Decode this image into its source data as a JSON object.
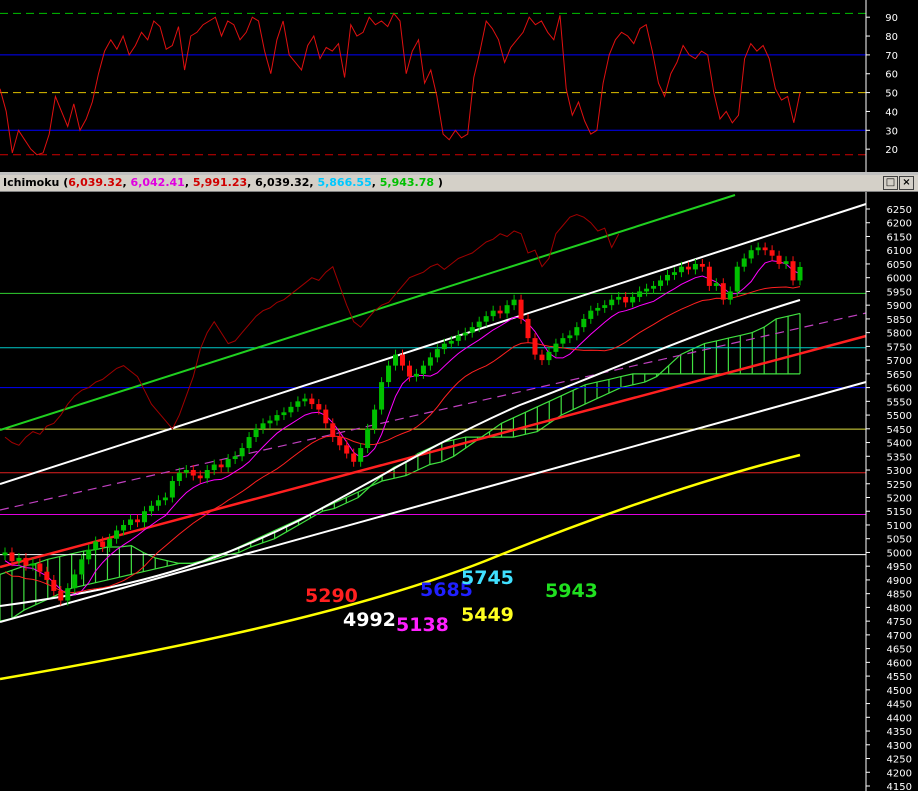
{
  "window": {
    "title": "Ichimoku",
    "values": [
      "6,039.32",
      "6,042.41",
      "5,991.23",
      "6,039.32",
      "5,866.55",
      "5,943.78"
    ],
    "value_colors": [
      "#d00000",
      "#e000e0",
      "#d00000",
      "#000000",
      "#00c8ff",
      "#00c000"
    ],
    "close_paren": ")",
    "restore_icon": "maximize-icon",
    "close_icon": "close-icon",
    "restore_glyph": "□",
    "close_glyph": "×"
  },
  "colors": {
    "background": "#000000",
    "oscillator": "#e01010",
    "up_candle": "#00c000",
    "down_candle": "#ff1010",
    "tenkan": "#ff00ff",
    "kijun": "#ff2020",
    "chikou": "#a00000",
    "cloud": "#40e040",
    "axis_text": "#ffffff"
  },
  "chart_data": [
    {
      "type": "line",
      "name": "oscillator",
      "ylim": [
        10,
        97
      ],
      "yticks": [
        20,
        30,
        40,
        50,
        60,
        70,
        80,
        90
      ],
      "reference_levels": [
        {
          "value": 92,
          "color": "#00c000",
          "dash": true
        },
        {
          "value": 70,
          "color": "#0000ff",
          "dash": false
        },
        {
          "value": 50,
          "color": "#e0c000",
          "dash": true
        },
        {
          "value": 30,
          "color": "#0000ff",
          "dash": false
        },
        {
          "value": 17,
          "color": "#d00000",
          "dash": true
        }
      ],
      "values": [
        52,
        40,
        18,
        30,
        25,
        20,
        17,
        18,
        28,
        48,
        40,
        32,
        44,
        30,
        36,
        45,
        60,
        72,
        78,
        73,
        80,
        70,
        75,
        82,
        78,
        88,
        85,
        73,
        75,
        85,
        62,
        80,
        82,
        86,
        88,
        90,
        80,
        88,
        86,
        78,
        82,
        90,
        88,
        72,
        60,
        78,
        88,
        70,
        66,
        62,
        75,
        80,
        68,
        74,
        72,
        76,
        58,
        86,
        80,
        82,
        90,
        86,
        88,
        85,
        92,
        88,
        60,
        72,
        78,
        55,
        62,
        48,
        28,
        25,
        30,
        26,
        28,
        58,
        72,
        88,
        84,
        78,
        66,
        74,
        78,
        82,
        90,
        86,
        88,
        82,
        78,
        91,
        52,
        38,
        45,
        35,
        28,
        30,
        55,
        70,
        78,
        82,
        80,
        76,
        84,
        86,
        72,
        55,
        48,
        60,
        66,
        75,
        70,
        68,
        72,
        70,
        50,
        36,
        40,
        34,
        38,
        68,
        76,
        72,
        75,
        68,
        52,
        46,
        48,
        34,
        50
      ],
      "chart_text": []
    },
    {
      "type": "candlestick",
      "name": "Ichimoku",
      "ylim": [
        4150,
        6300
      ],
      "yticks": [
        4150,
        4200,
        4250,
        4300,
        4350,
        4400,
        4450,
        4500,
        4550,
        4600,
        4650,
        4700,
        4750,
        4800,
        4850,
        4900,
        4950,
        5000,
        5050,
        5100,
        5150,
        5200,
        5250,
        5300,
        5350,
        5400,
        5450,
        5500,
        5550,
        5600,
        5650,
        5700,
        5750,
        5800,
        5850,
        5900,
        5950,
        6000,
        6050,
        6100,
        6150,
        6200,
        6250
      ],
      "close": [
        5000,
        4968,
        4980,
        4952,
        4960,
        4930,
        4900,
        4860,
        4825,
        4870,
        4920,
        4975,
        5010,
        5040,
        5020,
        5050,
        5080,
        5100,
        5120,
        5110,
        5150,
        5170,
        5190,
        5200,
        5260,
        5290,
        5300,
        5280,
        5270,
        5300,
        5320,
        5310,
        5340,
        5350,
        5380,
        5420,
        5450,
        5470,
        5480,
        5500,
        5510,
        5530,
        5550,
        5560,
        5540,
        5520,
        5470,
        5420,
        5390,
        5360,
        5330,
        5380,
        5450,
        5520,
        5620,
        5680,
        5720,
        5680,
        5640,
        5650,
        5680,
        5710,
        5740,
        5760,
        5770,
        5790,
        5800,
        5820,
        5840,
        5860,
        5880,
        5870,
        5900,
        5920,
        5850,
        5780,
        5720,
        5700,
        5730,
        5760,
        5780,
        5790,
        5820,
        5850,
        5880,
        5890,
        5900,
        5920,
        5930,
        5910,
        5930,
        5950,
        5960,
        5970,
        5990,
        6010,
        6020,
        6040,
        6030,
        6050,
        6040,
        5970,
        5980,
        5920,
        5950,
        6040,
        6070,
        6100,
        6110,
        6100,
        6080,
        6050,
        6060,
        5990,
        6039
      ],
      "cloud_top": [
        4920,
        4935,
        4950,
        4960,
        4975,
        4985,
        4995,
        5005,
        5010,
        5020,
        5020,
        5025,
        5000,
        4980,
        4970,
        4960,
        4960,
        4965,
        4975,
        4990,
        5000,
        5020,
        5035,
        5050,
        5075,
        5100,
        5125,
        5150,
        5160,
        5180,
        5200,
        5240,
        5280,
        5310,
        5330,
        5360,
        5380,
        5400,
        5410,
        5420,
        5420,
        5420,
        5420,
        5420,
        5430,
        5440,
        5470,
        5500,
        5520,
        5540,
        5560,
        5580,
        5600,
        5610,
        5620,
        5640,
        5680,
        5720,
        5740,
        5760,
        5770,
        5780,
        5790,
        5800,
        5820,
        5850,
        5860,
        5870
      ],
      "cloud_bottom": [
        4750,
        4760,
        4790,
        4810,
        4830,
        4850,
        4870,
        4880,
        4890,
        4900,
        4910,
        4920,
        4930,
        4940,
        4950,
        4960,
        4960,
        4970,
        4990,
        5000,
        5020,
        5040,
        5060,
        5080,
        5100,
        5120,
        5140,
        5160,
        5180,
        5200,
        5220,
        5240,
        5260,
        5270,
        5280,
        5300,
        5320,
        5330,
        5350,
        5380,
        5410,
        5440,
        5470,
        5490,
        5510,
        5530,
        5550,
        5570,
        5590,
        5610,
        5620,
        5630,
        5640,
        5650,
        5650,
        5650,
        5650,
        5650,
        5650,
        5650,
        5650,
        5650,
        5650,
        5650,
        5650,
        5650,
        5650,
        5650
      ],
      "horizontal_levels": [
        {
          "value": 5943,
          "color": "#30d030"
        },
        {
          "value": 5745,
          "color": "#00c8c8"
        },
        {
          "value": 5600,
          "color": "#0000ff"
        },
        {
          "value": 5449,
          "color": "#e0e040"
        },
        {
          "value": 5290,
          "color": "#e02020"
        },
        {
          "value": 5138,
          "color": "#e000e0"
        },
        {
          "value": 4992,
          "color": "#ffffff"
        }
      ],
      "level_labels": [
        {
          "text": "5290",
          "color": "#ff2020"
        },
        {
          "text": "4992",
          "color": "#ffffff"
        },
        {
          "text": "5138",
          "color": "#ff20ff"
        },
        {
          "text": "5685",
          "color": "#2020ff"
        },
        {
          "text": "5449",
          "color": "#ffff20"
        },
        {
          "text": "5745",
          "color": "#40e0ff"
        },
        {
          "text": "5943",
          "color": "#20e020"
        }
      ]
    }
  ]
}
